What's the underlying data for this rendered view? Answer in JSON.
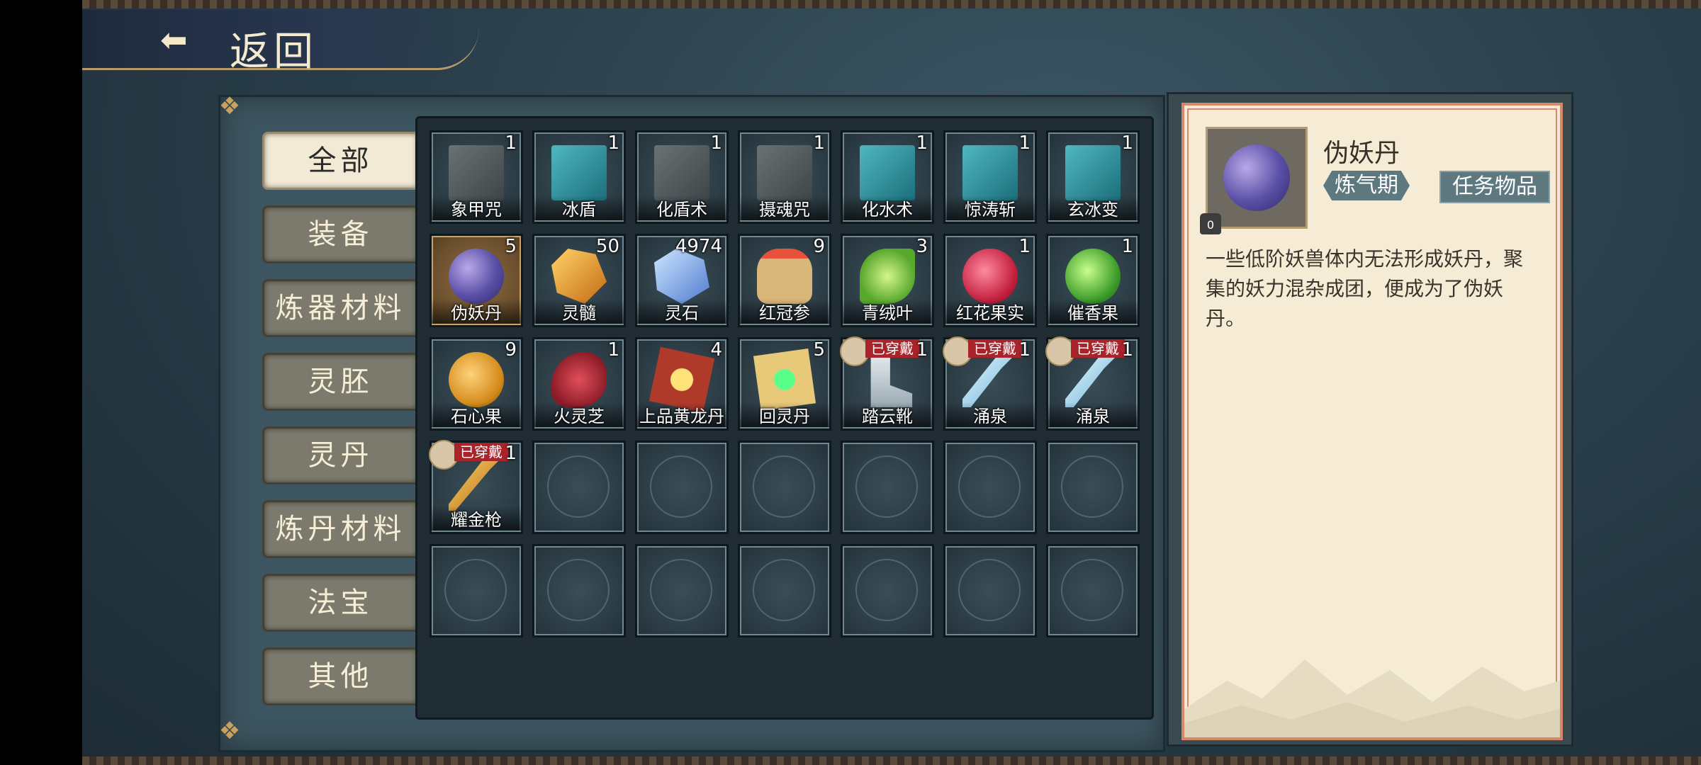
{
  "header": {
    "back_label": "返回",
    "back_icon": "cloud-arrow-icon"
  },
  "categories": [
    {
      "label": "全部",
      "active": true
    },
    {
      "label": "装备",
      "active": false
    },
    {
      "label": "炼器材料",
      "active": false
    },
    {
      "label": "灵胚",
      "active": false
    },
    {
      "label": "灵丹",
      "active": false
    },
    {
      "label": "炼丹材料",
      "active": false
    },
    {
      "label": "法宝",
      "active": false
    },
    {
      "label": "其他",
      "active": false
    }
  ],
  "items": [
    {
      "name": "象甲咒",
      "count": "1"
    },
    {
      "name": "冰盾",
      "count": "1"
    },
    {
      "name": "化盾术",
      "count": "1"
    },
    {
      "name": "摄魂咒",
      "count": "1"
    },
    {
      "name": "化水术",
      "count": "1"
    },
    {
      "name": "惊涛斩",
      "count": "1"
    },
    {
      "name": "玄冰变",
      "count": "1"
    },
    {
      "name": "伪妖丹",
      "count": "5"
    },
    {
      "name": "灵髓",
      "count": "50"
    },
    {
      "name": "灵石",
      "count": "4974"
    },
    {
      "name": "红冠参",
      "count": "9"
    },
    {
      "name": "青绒叶",
      "count": "3"
    },
    {
      "name": "红花果实",
      "count": "1"
    },
    {
      "name": "催香果",
      "count": "1"
    },
    {
      "name": "石心果",
      "count": "9"
    },
    {
      "name": "火灵芝",
      "count": "1"
    },
    {
      "name": "上品黄龙丹",
      "count": "4"
    },
    {
      "name": "回灵丹",
      "count": "5"
    },
    {
      "name": "踏云靴",
      "count": "1",
      "worn": "已穿戴"
    },
    {
      "name": "涌泉",
      "count": "1",
      "worn": "已穿戴"
    },
    {
      "name": "涌泉",
      "count": "1",
      "worn": "已穿戴"
    },
    {
      "name": "耀金枪",
      "count": "1",
      "worn": "已穿戴"
    }
  ],
  "detail": {
    "title": "伪妖丹",
    "realm": "炼气期",
    "type": "任务物品",
    "weight": "0",
    "description": "一些低阶妖兽体内无法形成妖丹，聚集的妖力混杂成团，便成为了伪妖丹。"
  },
  "colors": {
    "accent_red": "#a9242a",
    "gold": "#c9a463",
    "teal": "#5e7880"
  }
}
